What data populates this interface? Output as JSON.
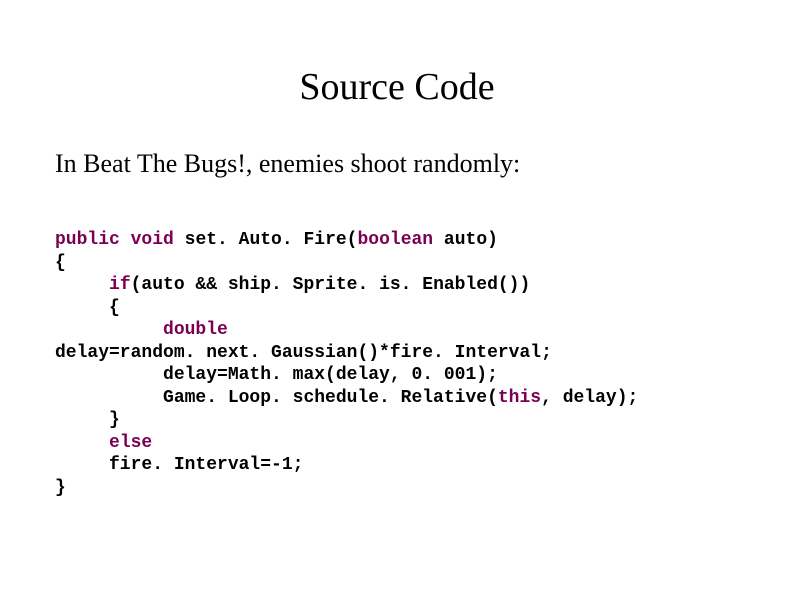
{
  "title": "Source Code",
  "intro": "In Beat The Bugs!, enemies shoot randomly:",
  "code": {
    "kw_public": "public",
    "kw_void": "void",
    "sig": " set. Auto. Fire(",
    "kw_boolean": "boolean",
    "sig_end": " auto)",
    "brace_open": "{",
    "indent1": "     ",
    "kw_if": "if",
    "if_cond": "(auto && ship. Sprite. is. Enabled())",
    "inner_brace_open": "     {",
    "indent2": "          ",
    "kw_double": "double",
    "delay_line": "delay=random. next. Gaussian()*fire. Interval;",
    "math_line": "          delay=Math. max(delay, 0. 001);",
    "schedule_pre": "          Game. Loop. schedule. Relative(",
    "kw_this": "this",
    "schedule_post": ", delay);",
    "inner_brace_close": "     }",
    "kw_else": "else",
    "else_body": "     fire. Interval=-1;",
    "brace_close": "}"
  }
}
